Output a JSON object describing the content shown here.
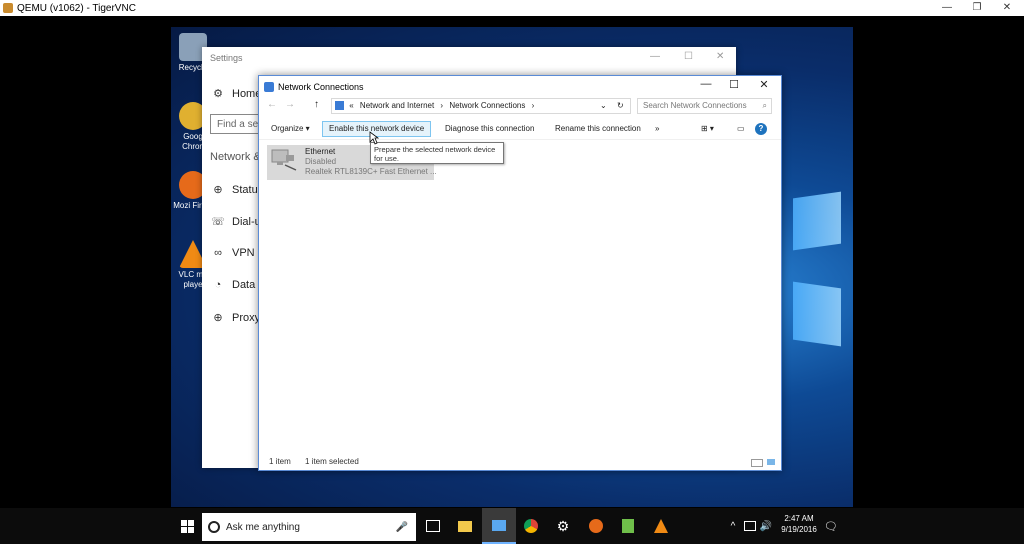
{
  "outer_window": {
    "title": "QEMU (v1062) - TigerVNC",
    "min": "—",
    "max": "❐",
    "close": "✕"
  },
  "desktop_icons": [
    {
      "label": "Recycle",
      "color": "#8aa0b8"
    },
    {
      "label": "Goog Chron",
      "color": "#e0b030"
    },
    {
      "label": "Mozi Firefo",
      "color": "#e66a1a"
    },
    {
      "label": "VLC me playe",
      "color": "#f08a14"
    }
  ],
  "settings": {
    "title": "Settings",
    "home": "Home",
    "find_placeholder": "Find a se",
    "section": "Network &",
    "nav": [
      {
        "label": "Status",
        "icon": "globe-icon",
        "glyph": "⊕"
      },
      {
        "label": "Dial-u",
        "icon": "dialup-icon",
        "glyph": "☏"
      },
      {
        "label": "VPN",
        "icon": "vpn-icon",
        "glyph": "∞"
      },
      {
        "label": "Data",
        "icon": "data-icon",
        "glyph": "◔"
      },
      {
        "label": "Proxy",
        "icon": "proxy-icon",
        "glyph": "⊕"
      }
    ],
    "gear_glyph": "⚙",
    "min": "—",
    "max": "☐",
    "close": "✕"
  },
  "network_connections": {
    "title": "Network Connections",
    "min": "—",
    "max": "☐",
    "close": "✕",
    "nav": {
      "back": "←",
      "forward": "→",
      "up": "↑"
    },
    "breadcrumb": {
      "prefix": "«",
      "part1": "Network and Internet",
      "sep1": "›",
      "part2": "Network Connections",
      "sep2": "›"
    },
    "dropdown": "⌄",
    "refresh": "↻",
    "search_placeholder": "Search Network Connections",
    "search_glyph": "⌕",
    "toolbar": {
      "organize": "Organize ▾",
      "enable": "Enable this network device",
      "diagnose": "Diagnose this connection",
      "rename": "Rename this connection",
      "more": "»",
      "view": "⊞ ▾",
      "pane": "▭",
      "help": "?"
    },
    "item": {
      "name": "Ethernet",
      "status": "Disabled",
      "device": "Realtek RTL8139C+ Fast Ethernet ..."
    },
    "tooltip": {
      "line1": "Prepare the selected network device",
      "line2": "for use."
    },
    "statusbar": {
      "count": "1 item",
      "selected": "1 item selected"
    }
  },
  "taskbar": {
    "search_text": "Ask me anything",
    "mic": "🎤",
    "time": "2:47 AM",
    "date": "9/19/2016",
    "tray": "^",
    "volume": "🔊",
    "notify": "🗨"
  },
  "colors": {
    "accent": "#0078d7",
    "hover": "#e5f3fb"
  }
}
